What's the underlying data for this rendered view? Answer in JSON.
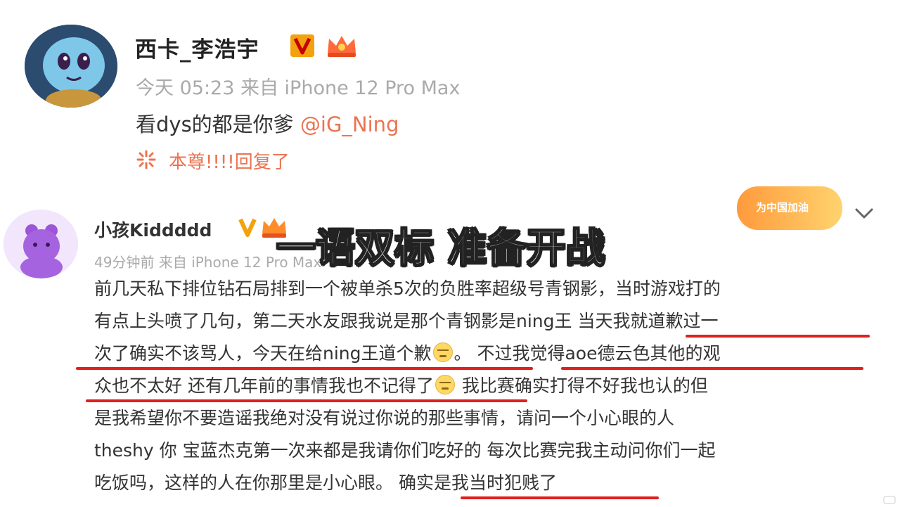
{
  "post1": {
    "username": "西卡_李浩宇",
    "timestamp": "今天 05:23 来自 iPhone 12 Pro Max",
    "content_text": "看dys的都是你爹 ",
    "mention": "@iG_Ning",
    "reply_status": "本尊!!!!回复了",
    "avatar_icon": "squirtle-avatar",
    "verified_icon": "v-badge-icon",
    "vip_icon": "crown-level-icon"
  },
  "post2": {
    "username": "小孩Kiddddd",
    "timestamp": "49分钟前 来自 iPhone 12 Pro Max",
    "campaign_badge": "为中国加油",
    "avatar_icon": "purple-bear-avatar",
    "menu_icon": "chevron-down-icon",
    "lines": [
      "前几天私下排位钻石局排到一个被单杀5次的负胜率超级号青钢影，当时游戏打的",
      "有点上头喷了几句，第二天水友跟我说是那个青钢影是ning王 当天我就道歉过一",
      "次了确实不该骂人，今天在给ning王道个歉",
      "。 不过我觉得aoe德云色其他的观",
      "众也不太好 还有几年前的事情我也不记得了",
      " 我比赛确实打得不好我也认的但",
      "是我希望你不要造谣我绝对没有说过你说的那些事情，请问一个小心眼的人",
      "theshy 你 宝蓝杰克第一次来都是我请你们吃好的 每次比赛完我主动问你们一起",
      "吃饭吗，这样的人在你那里是小心眼。 确实是我当时犯贱了"
    ]
  },
  "overlay_title": "一语双标 准备开战",
  "colors": {
    "accent_orange": "#eb7350",
    "underline_red": "#e0201d",
    "timestamp_gray": "#aaaaaa"
  }
}
